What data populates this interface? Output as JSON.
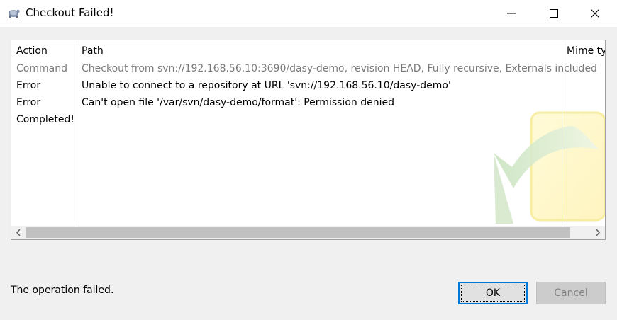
{
  "window": {
    "title": "Checkout Failed!"
  },
  "log": {
    "columns": [
      "Action",
      "Path",
      "Mime ty"
    ],
    "rows": [
      {
        "action": "Command",
        "path": "Checkout from svn://192.168.56.10:3690/dasy-demo, revision HEAD, Fully recursive, Externals included"
      },
      {
        "action": "Error",
        "path": "Unable to connect to a repository at URL 'svn://192.168.56.10/dasy-demo'"
      },
      {
        "action": "Error",
        "path": "Can't open file '/var/svn/dasy-demo/format': Permission denied"
      },
      {
        "action": "Completed!",
        "path": ""
      }
    ]
  },
  "footer": {
    "status": "The operation failed.",
    "ok_label": "OK",
    "cancel_label": "Cancel"
  },
  "colors": {
    "muted_text": "#7a7a7a",
    "focus_border": "#0078d7"
  }
}
